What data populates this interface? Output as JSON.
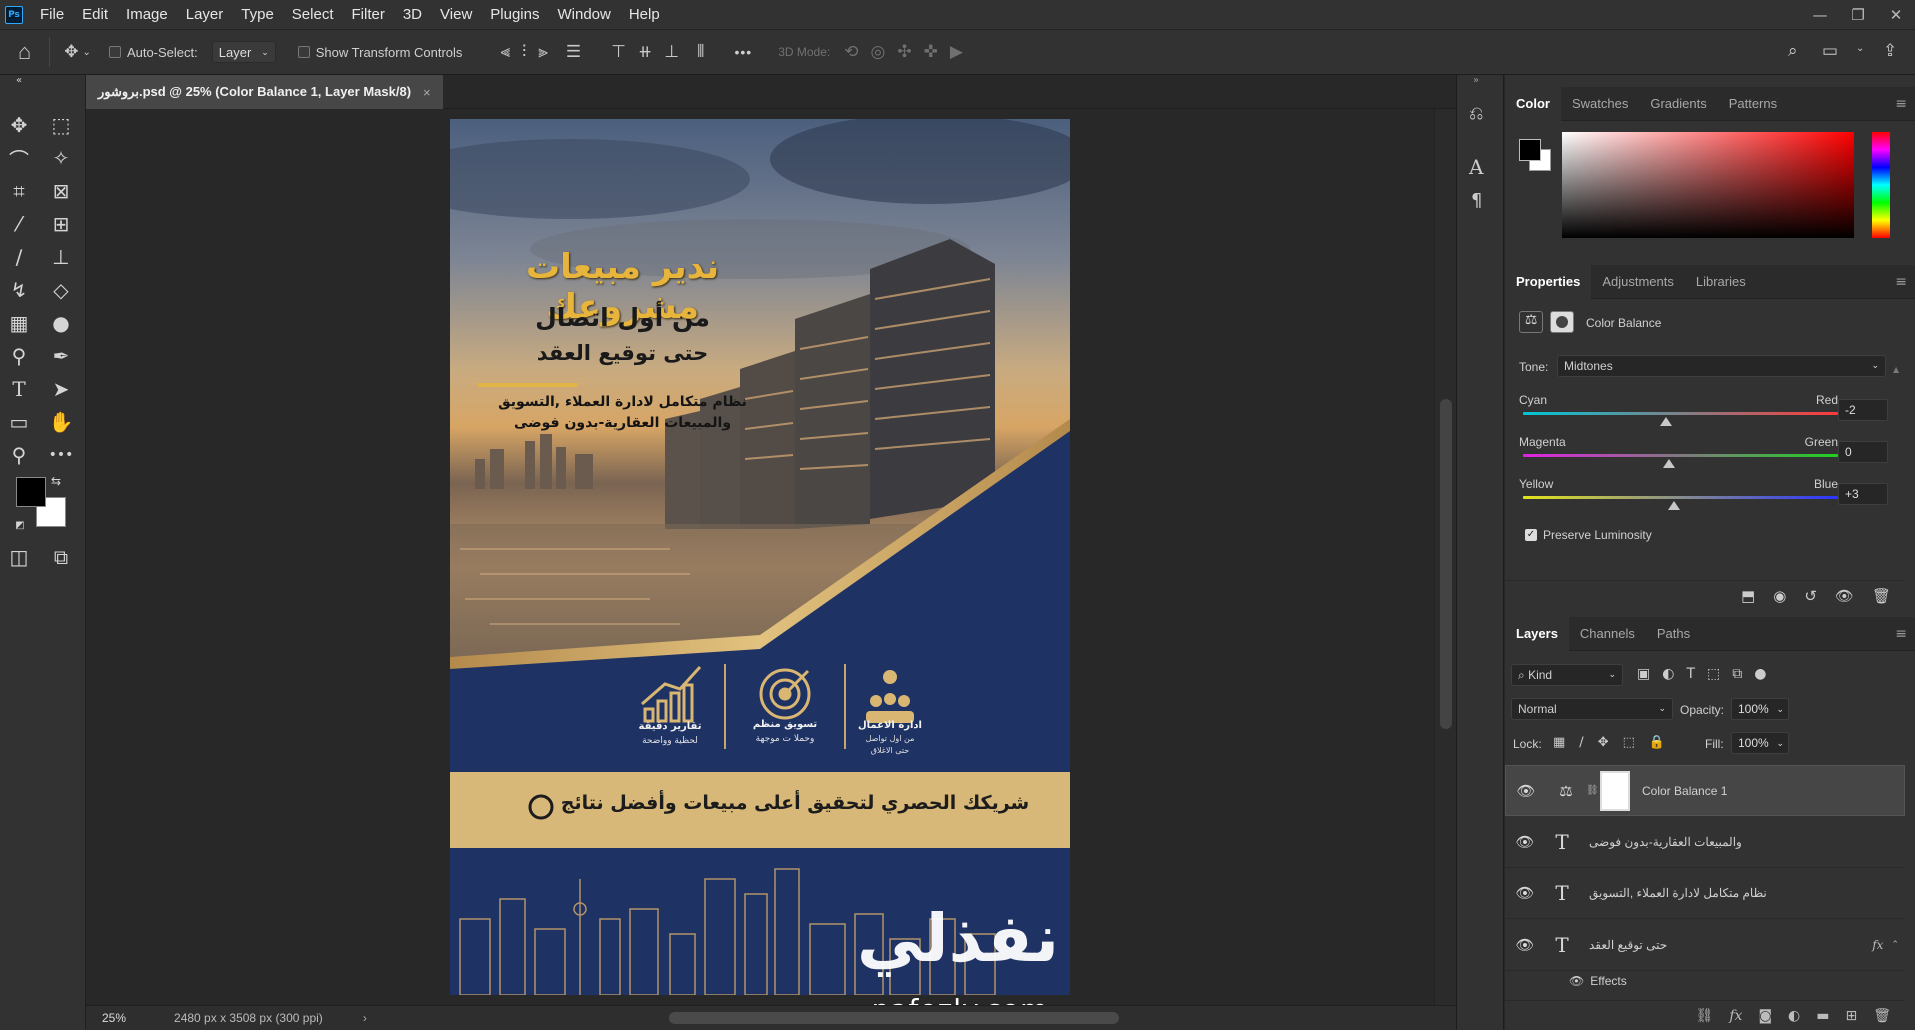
{
  "app": {
    "logo": "Ps"
  },
  "menu": [
    "File",
    "Edit",
    "Image",
    "Layer",
    "Type",
    "Select",
    "Filter",
    "3D",
    "View",
    "Plugins",
    "Window",
    "Help"
  ],
  "options": {
    "auto_select_label": "Auto-Select:",
    "auto_select_value": "Layer",
    "transform_label": "Show Transform Controls",
    "mode3d_label": "3D Mode:",
    "more": "•••"
  },
  "document": {
    "tab_title": "بروشور.psd @ 25% (Color Balance 1, Layer Mask/8)",
    "zoom": "25%",
    "dimensions": "2480 px x 3508 px (300 ppi)"
  },
  "poster": {
    "headline": "ندير مبيعات مشروعك",
    "line2": "من أول اتصال",
    "line3": "حتى توقيع العقد",
    "desc1": "نظام متكامل لادارة العملاء ,التسويق",
    "desc2": "والمبيعات العقارية-بدون فوضى",
    "feature1_title": "ادارة الاعمال",
    "feature1_sub1": "من اول تواصل",
    "feature1_sub2": "حتى الاغلاق",
    "feature2_title": "تسويق منظم",
    "feature2_sub": "وحملا ت موجهة",
    "feature3_title": "تقارير دقيقة",
    "feature3_sub": "لحظية وواضحة",
    "banner": "شريكك الحصري لتحقيق أعلى مبيعات وأفضل نتائج",
    "watermark_ar": "نفذلي",
    "watermark_en": "nafezly.com"
  },
  "color_panel": {
    "tabs": [
      "Color",
      "Swatches",
      "Gradients",
      "Patterns"
    ]
  },
  "properties_panel": {
    "tabs": [
      "Properties",
      "Adjustments",
      "Libraries"
    ],
    "title": "Color Balance",
    "tone_label": "Tone:",
    "tone_value": "Midtones",
    "sliders": [
      {
        "left": "Cyan",
        "right": "Red",
        "value": "-2"
      },
      {
        "left": "Magenta",
        "right": "Green",
        "value": "0"
      },
      {
        "left": "Yellow",
        "right": "Blue",
        "value": "+3"
      }
    ],
    "preserve_label": "Preserve Luminosity"
  },
  "layers_panel": {
    "tabs": [
      "Layers",
      "Channels",
      "Paths"
    ],
    "filter": "Kind",
    "blend_mode": "Normal",
    "opacity_label": "Opacity:",
    "opacity_value": "100%",
    "lock_label": "Lock:",
    "fill_label": "Fill:",
    "fill_value": "100%",
    "layers": [
      {
        "name": "Color Balance 1"
      },
      {
        "name": "والمبيعات العقارية-بدون فوضى"
      },
      {
        "name": "نظام متكامل لادارة العملاء ,التسويق"
      },
      {
        "name": "حتى توقيع العقد"
      }
    ],
    "effects_label": "Effects"
  }
}
